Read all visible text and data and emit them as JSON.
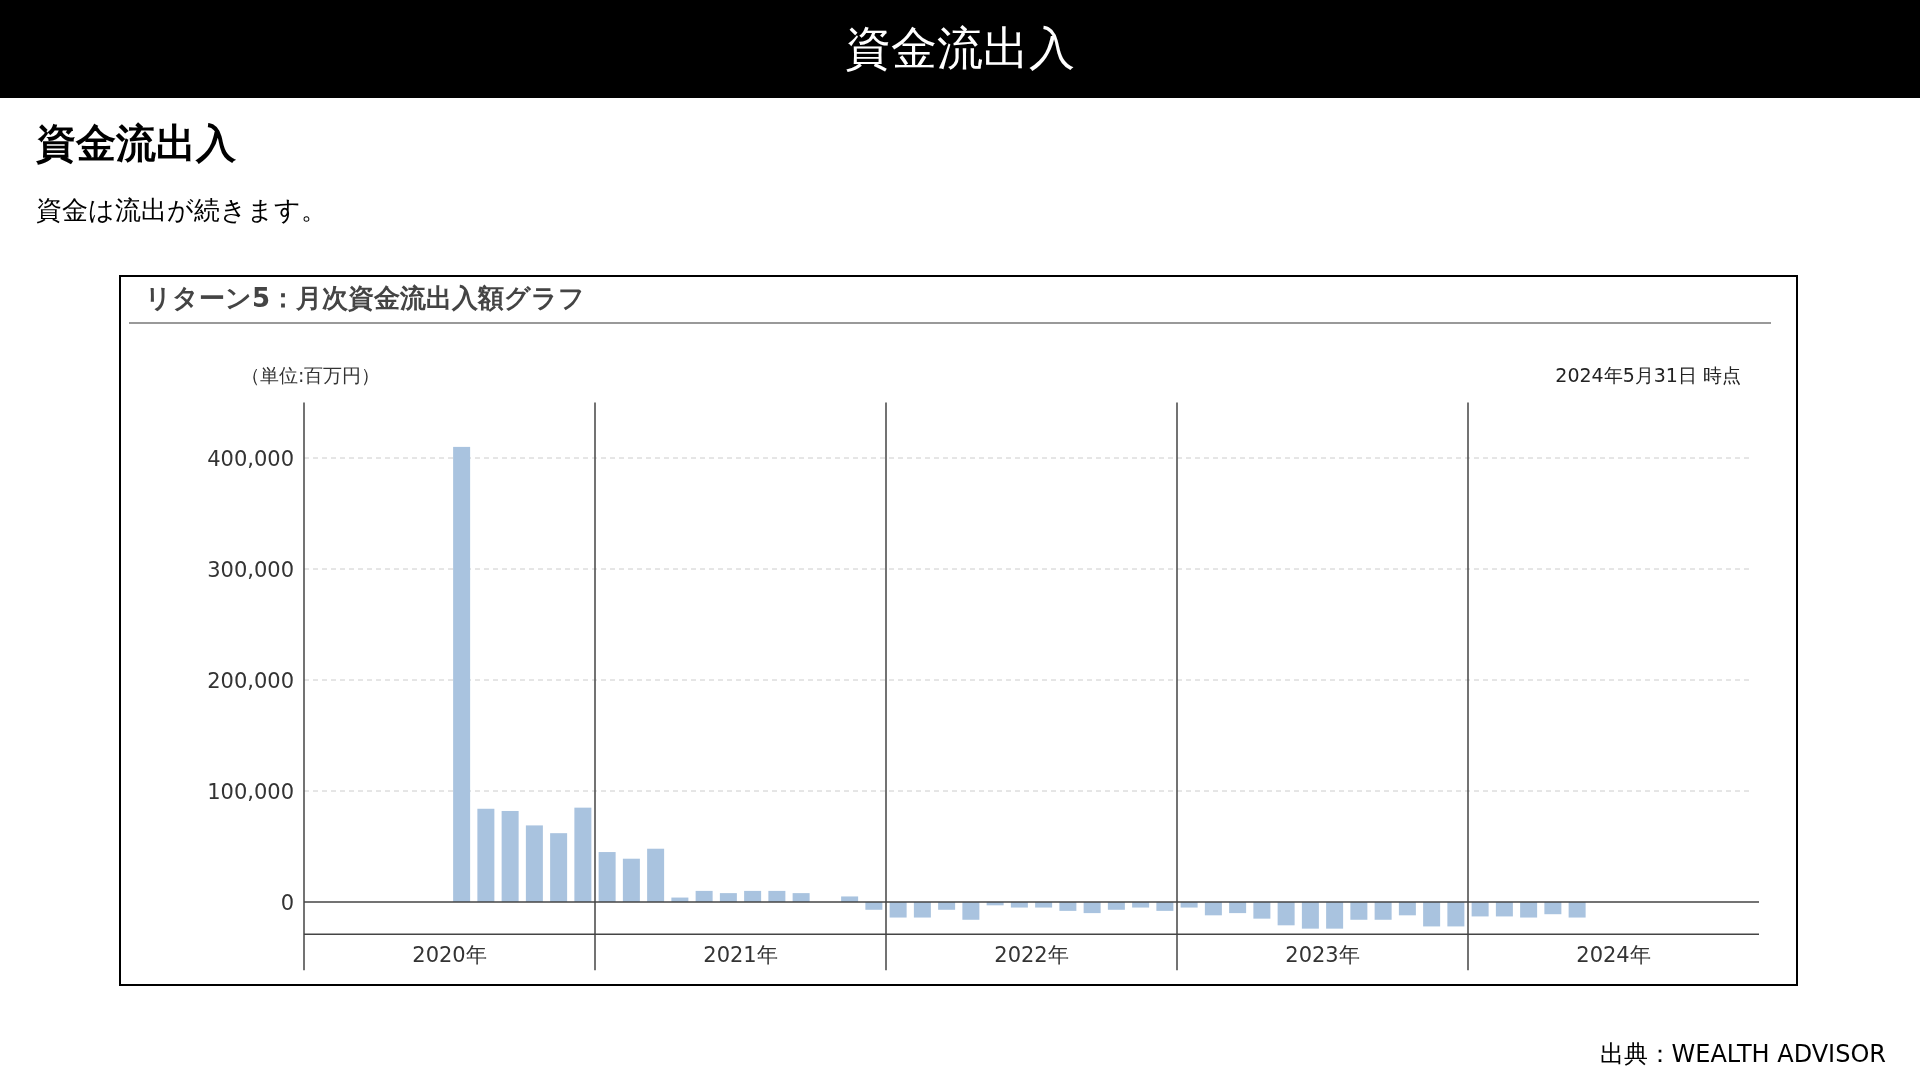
{
  "header": {
    "title": "資金流出入"
  },
  "heading": "資金流出入",
  "summary": "資金は流出が続きます。",
  "chart": {
    "title": "リターン5：月次資金流出入額グラフ",
    "as_of": "2024年5月31日 時点",
    "chart_data": {
      "type": "bar",
      "ylabel": "（単位:百万円）",
      "grid": true,
      "categories": [
        null,
        null,
        null,
        null,
        null,
        "2020年",
        null,
        null,
        null,
        null,
        null,
        null,
        null,
        null,
        null,
        null,
        null,
        "2021年",
        null,
        null,
        null,
        null,
        null,
        null,
        null,
        null,
        null,
        null,
        null,
        "2022年",
        null,
        null,
        null,
        null,
        null,
        null,
        null,
        null,
        null,
        null,
        null,
        "2023年",
        null,
        null,
        null,
        null,
        null,
        null,
        null,
        null,
        null,
        null,
        null,
        "2024年",
        null,
        null,
        null,
        null,
        null,
        null
      ],
      "series": [
        {
          "color": "#a9c3df",
          "values": [
            null,
            null,
            null,
            null,
            null,
            null,
            410000,
            84000,
            82000,
            69000,
            62000,
            85000,
            45000,
            39000,
            48000,
            4000,
            10000,
            8000,
            10000,
            10000,
            8000,
            null,
            5000,
            -7000,
            -14000,
            -14000,
            -7000,
            -16000,
            -3000,
            -5000,
            -5000,
            -8000,
            -10000,
            -7000,
            -5000,
            -8000,
            -5000,
            -12000,
            -10000,
            -15000,
            -21000,
            -24000,
            -24000,
            -16000,
            -16000,
            -12000,
            -22000,
            -22000,
            -13000,
            -13000,
            -14000,
            -11000,
            -14000,
            null,
            null,
            null,
            null,
            null,
            null,
            null
          ]
        }
      ],
      "ylim": [
        -29000,
        450000
      ],
      "yticks": [
        {
          "value": 0,
          "label": "0"
        },
        {
          "value": 100000,
          "label": "100,000"
        },
        {
          "value": 200000,
          "label": "200,000"
        },
        {
          "value": 300000,
          "label": "300,000"
        },
        {
          "value": 400000,
          "label": "400,000"
        }
      ]
    }
  },
  "source": "出典：WEALTH ADVISOR"
}
